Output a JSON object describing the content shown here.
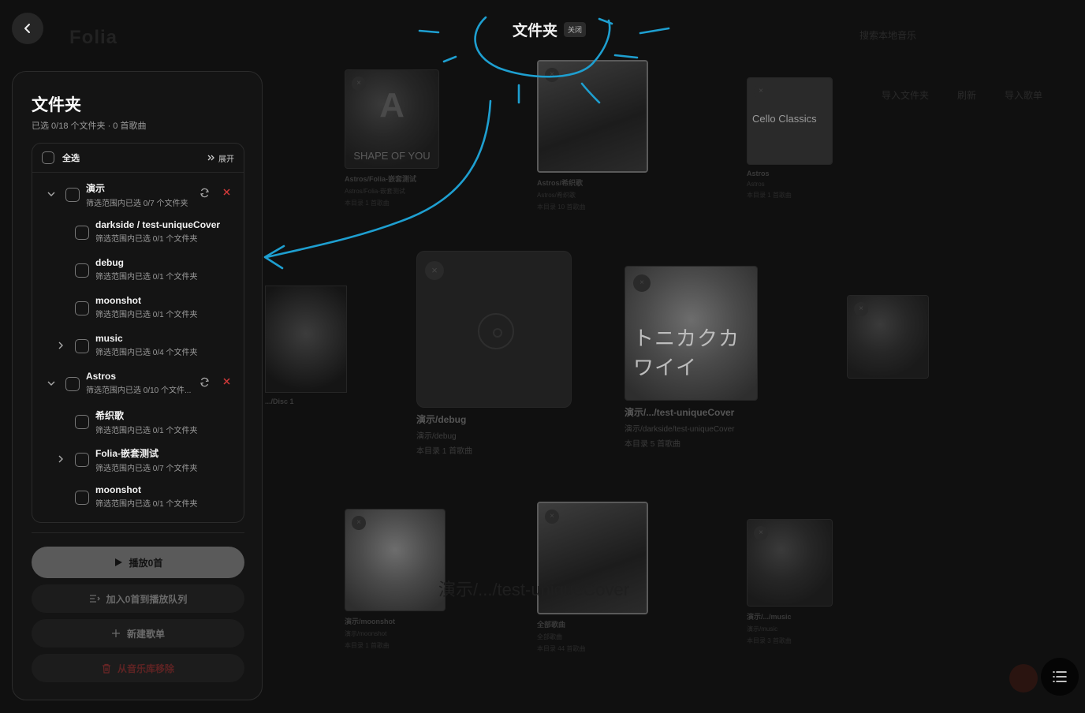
{
  "app": {
    "logo": "Folia",
    "search_placeholder": "搜索本地音乐",
    "actions": [
      "导入文件夹",
      "刷新",
      "导入歌单"
    ]
  },
  "header": {
    "title": "文件夹",
    "close_label": "关闭"
  },
  "panel": {
    "title": "文件夹",
    "subtitle": "已选 0/18 个文件夹 · 0 首歌曲",
    "select_all": "全选",
    "expand": "展开",
    "tree": [
      {
        "name": "演示",
        "meta": "筛选范围内已选 0/7 个文件夹",
        "level": 0,
        "chevron": "down",
        "actions": true
      },
      {
        "name": "darkside / test-uniqueCover",
        "meta": "筛选范围内已选 0/1 个文件夹",
        "level": 1,
        "chevron": ""
      },
      {
        "name": "debug",
        "meta": "筛选范围内已选 0/1 个文件夹",
        "level": 1,
        "chevron": ""
      },
      {
        "name": "moonshot",
        "meta": "筛选范围内已选 0/1 个文件夹",
        "level": 1,
        "chevron": ""
      },
      {
        "name": "music",
        "meta": "筛选范围内已选 0/4 个文件夹",
        "level": 1,
        "chevron": "right"
      },
      {
        "name": "Astros",
        "meta": "筛选范围内已选 0/10 个文件...",
        "level": 0,
        "chevron": "down",
        "actions": true
      },
      {
        "name": "希织歌",
        "meta": "筛选范围内已选 0/1 个文件夹",
        "level": 1,
        "chevron": ""
      },
      {
        "name": "Folia-嵌套测试",
        "meta": "筛选范围内已选 0/7 个文件夹",
        "level": 1,
        "chevron": "right"
      },
      {
        "name": "moonshot",
        "meta": "筛选范围内已选 0/1 个文件夹",
        "level": 1,
        "chevron": ""
      }
    ],
    "buttons": {
      "play": "播放0首",
      "queue": "加入0首到播放队列",
      "new_playlist": "新建歌单",
      "remove": "从音乐库移除"
    }
  },
  "background_cards": [
    {
      "t1": "Astros/Folia-嵌套测试",
      "t2": "Astros/Folia-嵌套测试",
      "t3": "本目录 1 首歌曲"
    },
    {
      "t1": "Astros/希织歌",
      "t2": "Astros/希织歌",
      "t3": "本目录 10 首歌曲"
    },
    {
      "t1": "Astros",
      "t2": "Astros",
      "t3": "本目录 1 首歌曲"
    },
    {
      "t1": ".../Disc 1",
      "t2": "",
      "t3": ""
    },
    {
      "t1": "演示/debug",
      "t2": "演示/debug",
      "t3": "本目录 1 首歌曲"
    },
    {
      "t1": "演示/.../test-uniqueCover",
      "t2": "演示/darkside/test-uniqueCover",
      "t3": "本目录 5 首歌曲"
    },
    {
      "t1": "演示/moonshot",
      "t2": "演示/moonshot",
      "t3": "本目录 1 首歌曲"
    },
    {
      "t1": "全部歌曲",
      "t2": "全部歌曲",
      "t3": "本目录 44 首歌曲"
    },
    {
      "t1": "演示/.../music",
      "t2": "演示/music",
      "t3": "本目录 3 首歌曲"
    }
  ],
  "cover_text": {
    "capella_letter": "A",
    "capella_title": "SHAPE OF YOU",
    "cello": "Cello Classics",
    "kana": "トニカクカワイイ"
  },
  "ghost_text": "演示/.../test-uniqueCover",
  "colors": {
    "accent_scribble": "#1e9fd0",
    "delete_red": "#d23a3a",
    "panel_bg": "#141414"
  }
}
